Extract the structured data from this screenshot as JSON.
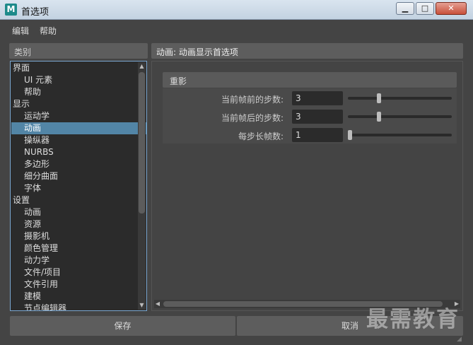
{
  "window": {
    "icon_letter": "M",
    "title": "首选项",
    "controls": {
      "minimize": "▁",
      "maximize": "□",
      "close": "✕"
    }
  },
  "menu": [
    "编辑",
    "帮助"
  ],
  "categories": {
    "header": "类别",
    "items": [
      {
        "label": "界面",
        "level": 0
      },
      {
        "label": "UI 元素",
        "level": 1
      },
      {
        "label": "帮助",
        "level": 1
      },
      {
        "label": "显示",
        "level": 0
      },
      {
        "label": "运动学",
        "level": 1
      },
      {
        "label": "动画",
        "level": 1,
        "selected": true
      },
      {
        "label": "操纵器",
        "level": 1
      },
      {
        "label": "NURBS",
        "level": 1
      },
      {
        "label": "多边形",
        "level": 1
      },
      {
        "label": "细分曲面",
        "level": 1
      },
      {
        "label": "字体",
        "level": 1
      },
      {
        "label": "设置",
        "level": 0
      },
      {
        "label": "动画",
        "level": 1
      },
      {
        "label": "资源",
        "level": 1
      },
      {
        "label": "摄影机",
        "level": 1
      },
      {
        "label": "颜色管理",
        "level": 1
      },
      {
        "label": "动力学",
        "level": 1
      },
      {
        "label": "文件/项目",
        "level": 1
      },
      {
        "label": "文件引用",
        "level": 1
      },
      {
        "label": "建模",
        "level": 1
      },
      {
        "label": "节点编辑器",
        "level": 1
      }
    ]
  },
  "panel": {
    "header": "动画: 动画显示首选项",
    "section": "重影",
    "fields": [
      {
        "label": "当前帧前的步数:",
        "value": "3",
        "slider_fraction": 0.29
      },
      {
        "label": "当前帧后的步数:",
        "value": "3",
        "slider_fraction": 0.29
      },
      {
        "label": "每步长帧数:",
        "value": "1",
        "slider_fraction": 0.0
      }
    ]
  },
  "buttons": {
    "save": "保存",
    "cancel": "取消"
  },
  "watermark": "最需教育",
  "colors": {
    "selection": "#5285a6",
    "tree_border": "#7aa7d1"
  }
}
